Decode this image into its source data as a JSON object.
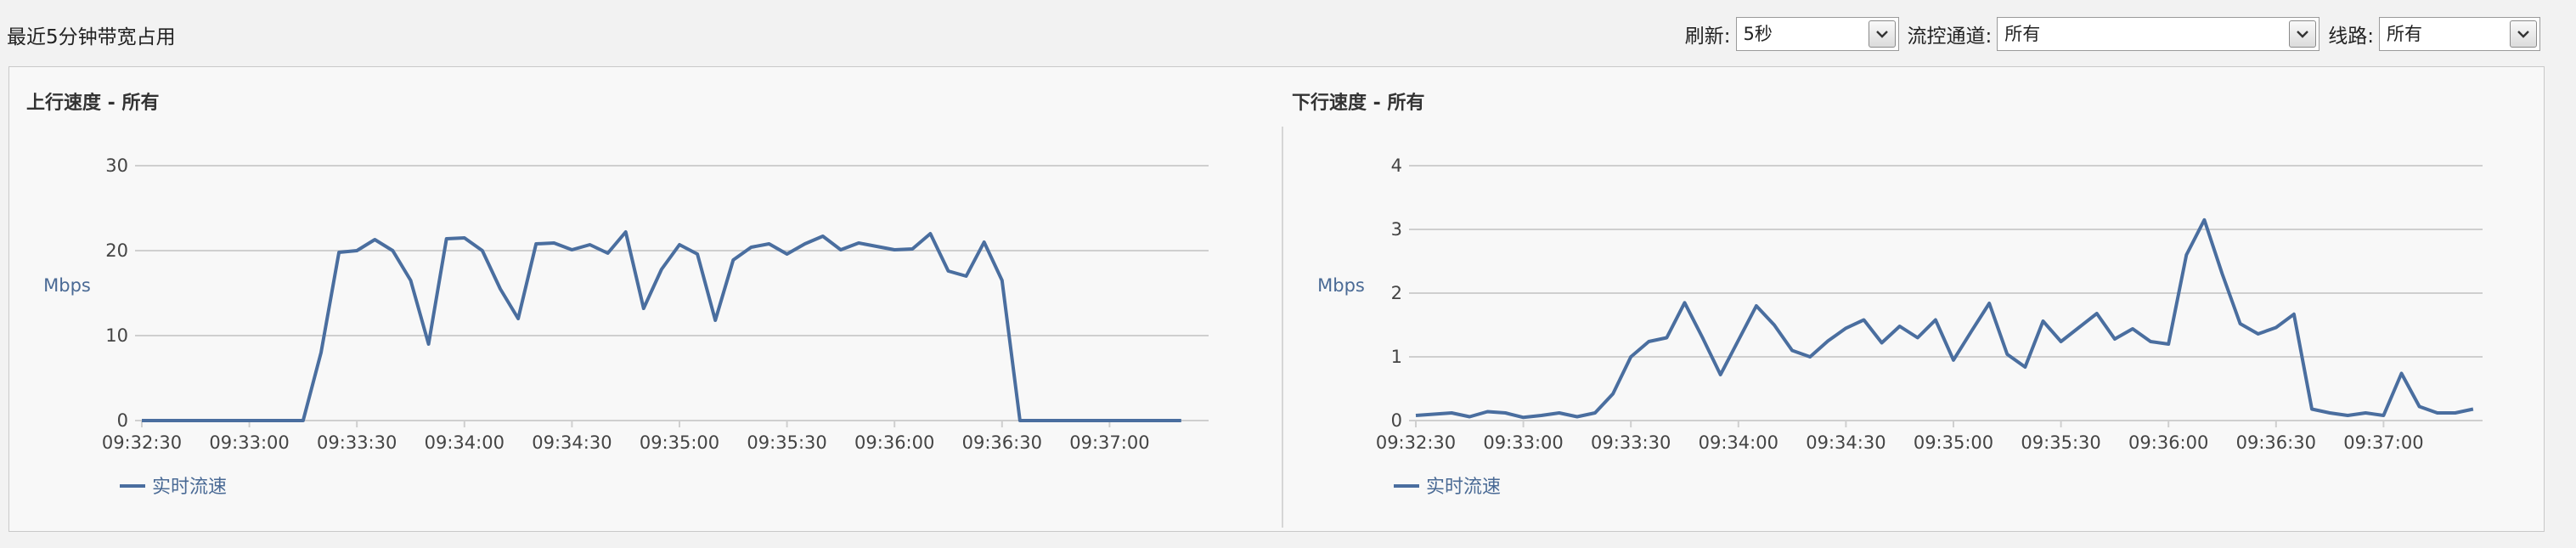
{
  "page": {
    "title": "最近5分钟带宽占用",
    "controls": {
      "refresh_label": "刷新:",
      "refresh_value": "5秒",
      "channel_label": "流控通道:",
      "channel_value": "所有",
      "line_label": "线路:",
      "line_value": "所有"
    }
  },
  "colors": {
    "series": "#4a6e9f",
    "grid": "#cfcfcf"
  },
  "icons": [
    "chevron-down-icon"
  ],
  "chart_data": [
    {
      "type": "line",
      "title": "上行速度 - 所有",
      "ylabel": "Mbps",
      "ylim": [
        0,
        30
      ],
      "yticks": [
        "0",
        "10",
        "20",
        "30"
      ],
      "x_tick_labels": [
        "09:32:30",
        "09:33:00",
        "09:33:30",
        "09:34:00",
        "09:34:30",
        "09:35:00",
        "09:35:30",
        "09:36:00",
        "09:36:30",
        "09:37:00"
      ],
      "legend": "实时流速",
      "series": [
        {
          "name": "实时流速",
          "values": [
            0,
            0,
            0,
            0,
            0,
            0,
            0,
            0,
            0,
            0,
            8,
            19.8,
            20,
            21.3,
            20,
            16.5,
            9,
            21.4,
            21.5,
            20,
            15.5,
            12,
            20.8,
            20.9,
            20.1,
            20.7,
            19.7,
            22.2,
            13.2,
            17.8,
            20.7,
            19.6,
            11.8,
            18.9,
            20.4,
            20.8,
            19.6,
            20.8,
            21.7,
            20.1,
            20.9,
            20.5,
            20.1,
            20.2,
            22,
            17.6,
            17,
            21,
            16.5,
            0,
            0,
            0,
            0,
            0,
            0,
            0,
            0,
            0,
            0
          ]
        }
      ]
    },
    {
      "type": "line",
      "title": "下行速度 - 所有",
      "ylabel": "Mbps",
      "ylim": [
        0,
        4
      ],
      "yticks": [
        "0",
        "1",
        "2",
        "3",
        "4"
      ],
      "x_tick_labels": [
        "09:32:30",
        "09:33:00",
        "09:33:30",
        "09:34:00",
        "09:34:30",
        "09:35:00",
        "09:35:30",
        "09:36:00",
        "09:36:30",
        "09:37:00"
      ],
      "legend": "实时流速",
      "series": [
        {
          "name": "实时流速",
          "values": [
            0.08,
            0.1,
            0.12,
            0.06,
            0.14,
            0.12,
            0.05,
            0.08,
            0.12,
            0.06,
            0.12,
            0.42,
            1.0,
            1.24,
            1.3,
            1.85,
            1.3,
            0.72,
            1.26,
            1.8,
            1.5,
            1.1,
            1.0,
            1.25,
            1.45,
            1.58,
            1.22,
            1.48,
            1.3,
            1.58,
            0.95,
            1.4,
            1.84,
            1.04,
            0.84,
            1.56,
            1.24,
            1.46,
            1.68,
            1.28,
            1.44,
            1.24,
            1.2,
            2.6,
            3.15,
            2.3,
            1.52,
            1.36,
            1.46,
            1.67,
            0.18,
            0.12,
            0.08,
            0.12,
            0.08,
            0.74,
            0.22,
            0.12,
            0.12,
            0.18
          ]
        }
      ]
    }
  ]
}
